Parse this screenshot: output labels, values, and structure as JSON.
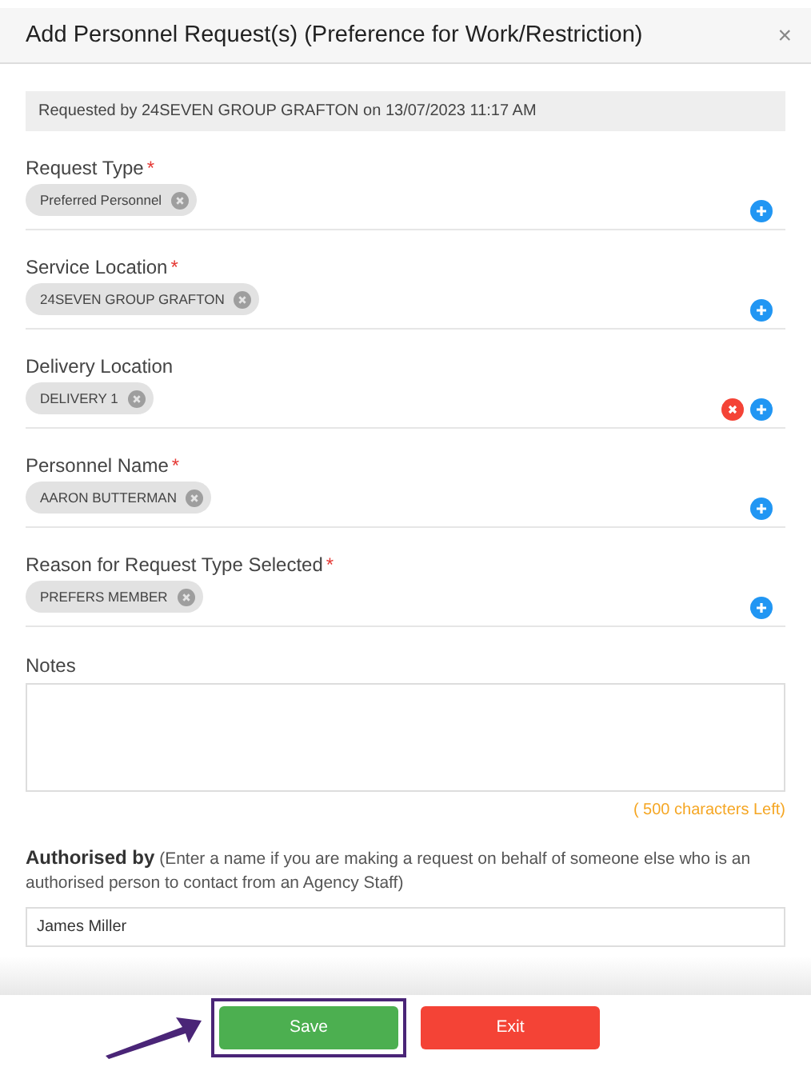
{
  "dialog": {
    "title": "Add Personnel Request(s) (Preference for Work/Restriction)",
    "close": "×"
  },
  "requested_by": "Requested by 24SEVEN GROUP GRAFTON on 13/07/2023 11:17 AM",
  "fields": [
    {
      "label": "Request Type",
      "required_mark": "*",
      "chip": "Preferred Personnel",
      "clearable": false
    },
    {
      "label": "Service Location",
      "required_mark": "*",
      "chip": "24SEVEN GROUP GRAFTON",
      "clearable": false
    },
    {
      "label": "Delivery Location",
      "chip": "DELIVERY 1",
      "clearable": true
    },
    {
      "label": "Personnel Name",
      "required_mark": "*",
      "chip": "AARON BUTTERMAN",
      "clearable": false
    },
    {
      "label": "Reason for Request Type Selected",
      "required_mark": "*",
      "chip": "PREFERS MEMBER",
      "clearable": false
    }
  ],
  "notes": {
    "label": "Notes",
    "counter": "( 500 characters Left)"
  },
  "authorised": {
    "label": "**Authorised by** (Enter a name if you are making a request on behalf of someone else who is an authorised person to contact from an Agency Staff)",
    "value": "James Miller"
  },
  "buttons": [
    {
      "label": "Save",
      "kind": "save",
      "highlighted": true
    },
    {
      "label": "Exit",
      "kind": "exit",
      "highlighted": false
    }
  ]
}
